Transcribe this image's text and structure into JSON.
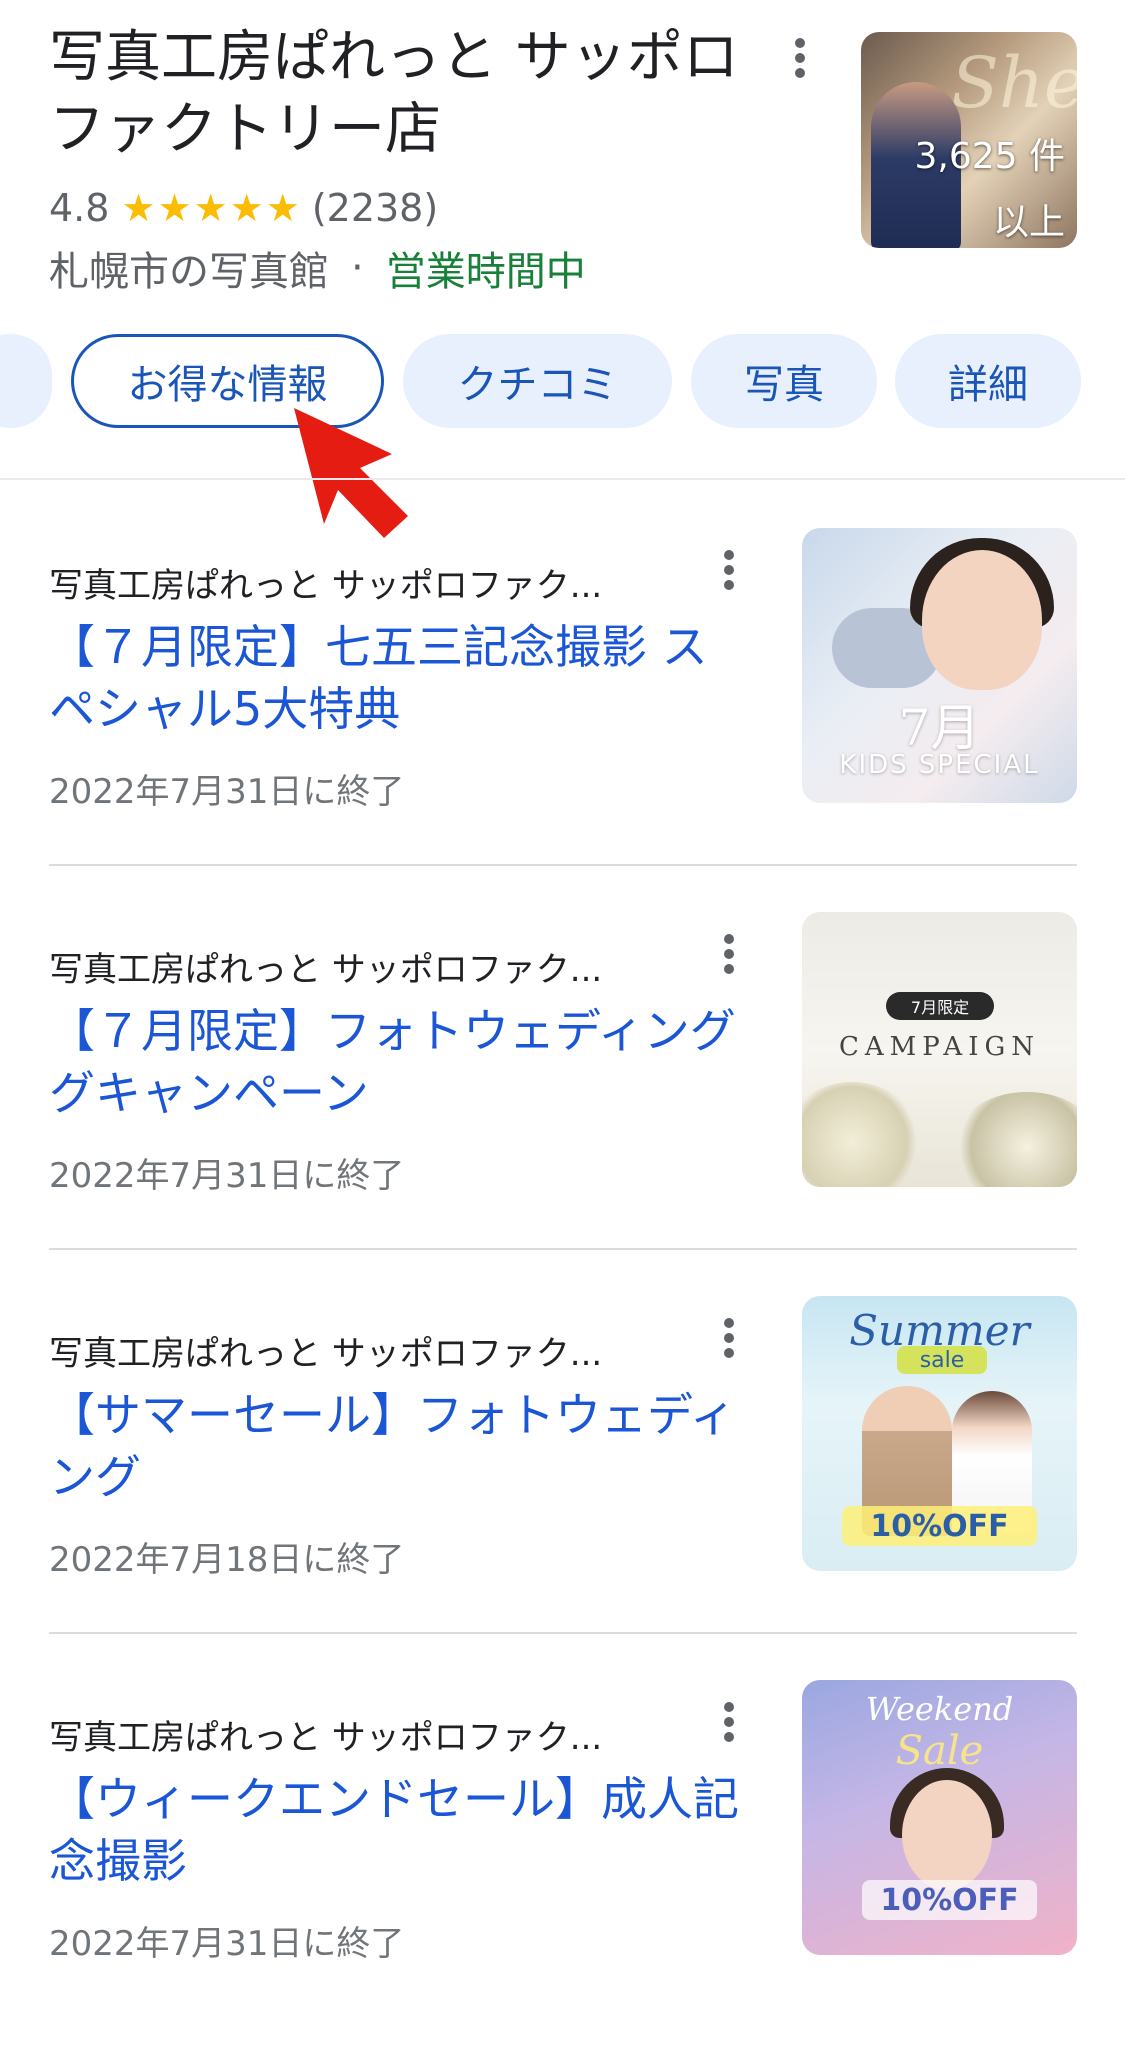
{
  "business": {
    "name": "写真工房ぱれっと サッポロファクトリー店",
    "rating": "4.8",
    "stars": [
      "★",
      "★",
      "★",
      "★",
      "★"
    ],
    "review_count": "(2238)",
    "category": "札幌市の写真館",
    "separator": "·",
    "status": "営業時間中",
    "photo_count_line1": "3,625 件",
    "photo_count_line2": "以上"
  },
  "colors": {
    "link_blue": "#1a56d6",
    "chip_bg": "#e8f0fe",
    "status_green": "#188038",
    "star_yellow": "#fbbc04",
    "annotation_arrow": "#e41c12"
  },
  "chips": [
    {
      "label": "お得な情報",
      "active": true
    },
    {
      "label": "クチコミ",
      "active": false
    },
    {
      "label": "写真",
      "active": false
    },
    {
      "label": "詳細",
      "active": false
    }
  ],
  "posts": [
    {
      "source": "写真工房ぱれっと サッポロファク...",
      "title": "【７月限定】七五三記念撮影 スペシャル5大特典",
      "date": "2022年7月31日に終了",
      "thumb_text": [
        "7月",
        "KIDS SPECIAL"
      ]
    },
    {
      "source": "写真工房ぱれっと サッポロファク...",
      "title": "【７月限定】フォトウェディンググキャンペーン",
      "date": "2022年7月31日に終了",
      "thumb_text": [
        "7月限定",
        "CAMPAIGN"
      ]
    },
    {
      "source": "写真工房ぱれっと サッポロファク...",
      "title": "【サマーセール】フォトウェディング",
      "date": "2022年7月18日に終了",
      "thumb_text": [
        "Summer",
        "sale",
        "10%OFF"
      ]
    },
    {
      "source": "写真工房ぱれっと サッポロファク...",
      "title": "【ウィークエンドセール】成人記念撮影",
      "date": "2022年7月31日に終了",
      "thumb_text": [
        "Weekend",
        "Sale",
        "10%OFF"
      ]
    }
  ]
}
